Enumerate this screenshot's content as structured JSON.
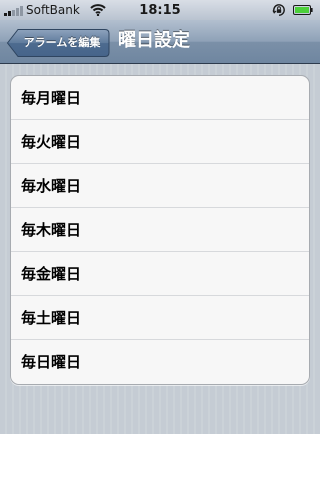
{
  "status_bar": {
    "carrier": "SoftBank",
    "time": "18:15",
    "signal_bars_filled": 2,
    "signal_bars_total": 5,
    "icons": [
      "signal-icon",
      "wifi-icon",
      "orientation-lock-icon",
      "battery-icon"
    ]
  },
  "nav": {
    "back_label": "アラームを編集",
    "title": "曜日設定"
  },
  "days": {
    "items": [
      {
        "label": "毎月曜日"
      },
      {
        "label": "毎火曜日"
      },
      {
        "label": "毎水曜日"
      },
      {
        "label": "毎木曜日"
      },
      {
        "label": "毎金曜日"
      },
      {
        "label": "毎土曜日"
      },
      {
        "label": "毎日曜日"
      }
    ]
  },
  "colors": {
    "nav_bar": "#7b90a8",
    "background": "#c5ccd4",
    "battery_fill": "#4cd03a"
  }
}
